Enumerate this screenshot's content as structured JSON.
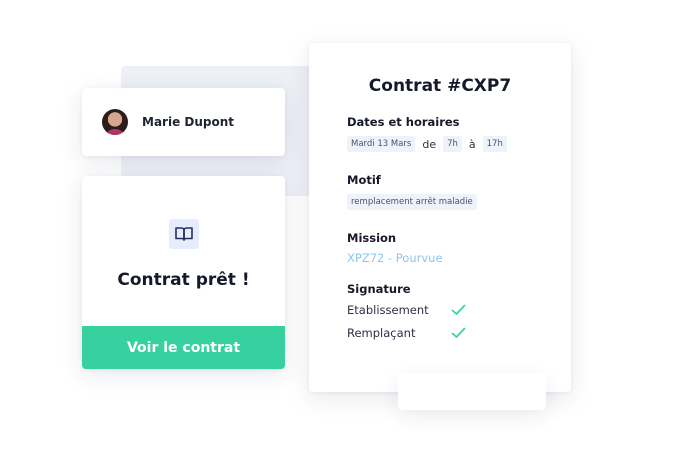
{
  "user": {
    "name": "Marie Dupont"
  },
  "ready": {
    "title": "Contrat prêt !",
    "button_label": "Voir le contrat",
    "icon": "book-icon"
  },
  "contract": {
    "title": "Contrat #CXP7",
    "dates": {
      "label": "Dates et horaires",
      "date": "Mardi 13 Mars",
      "from_word": "de",
      "start": "7h",
      "to_word": "à",
      "end": "17h"
    },
    "motif": {
      "label": "Motif",
      "value": "remplacement arrêt maladie"
    },
    "mission": {
      "label": "Mission",
      "value": "XPZ72 - Pourvue"
    },
    "signature": {
      "label": "Signature",
      "items": [
        {
          "label": "Etablissement",
          "signed": true
        },
        {
          "label": "Remplaçant",
          "signed": true
        }
      ]
    }
  },
  "colors": {
    "accent": "#36d19f",
    "mission": "#8cc6f0",
    "check": "#36d19f"
  }
}
